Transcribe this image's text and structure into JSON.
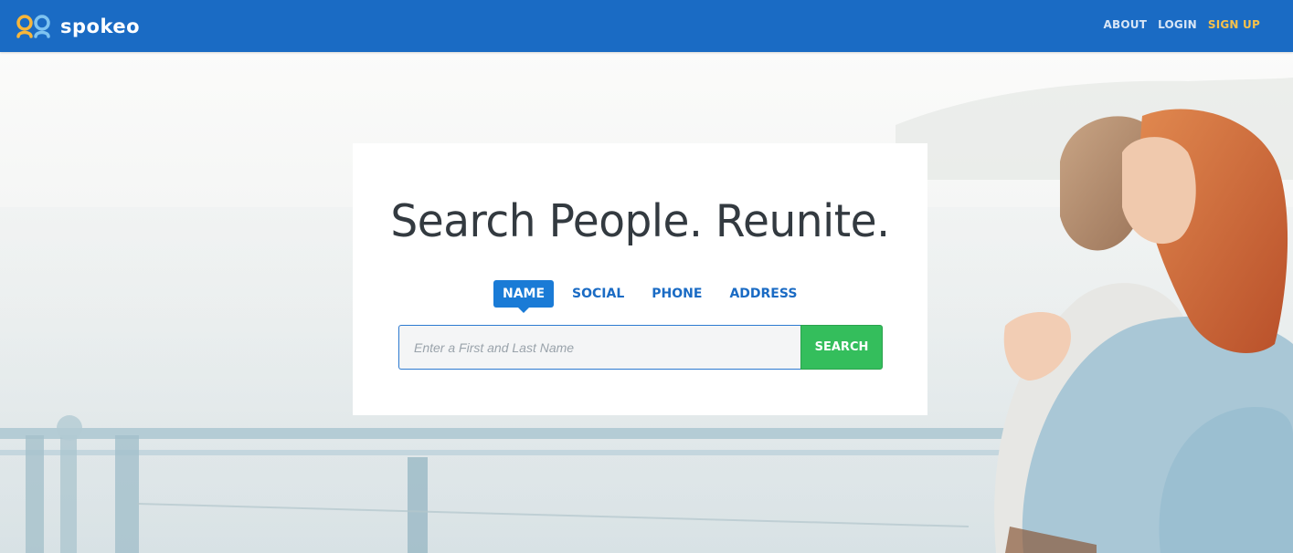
{
  "brand": {
    "name": "spokeo"
  },
  "nav": {
    "about": "ABOUT",
    "login": "LOGIN",
    "signup": "SIGN UP"
  },
  "hero": {
    "headline": "Search People. Reunite.",
    "tabs": [
      {
        "label": "NAME",
        "active": true
      },
      {
        "label": "SOCIAL",
        "active": false
      },
      {
        "label": "PHONE",
        "active": false
      },
      {
        "label": "ADDRESS",
        "active": false
      }
    ],
    "search": {
      "placeholder": "Enter a First and Last Name",
      "value": "",
      "button_label": "SEARCH"
    }
  },
  "colors": {
    "nav_bg": "#1a6bc4",
    "accent_signup": "#f6c14a",
    "search_button": "#34be5c",
    "active_tab": "#1a7bd6"
  }
}
